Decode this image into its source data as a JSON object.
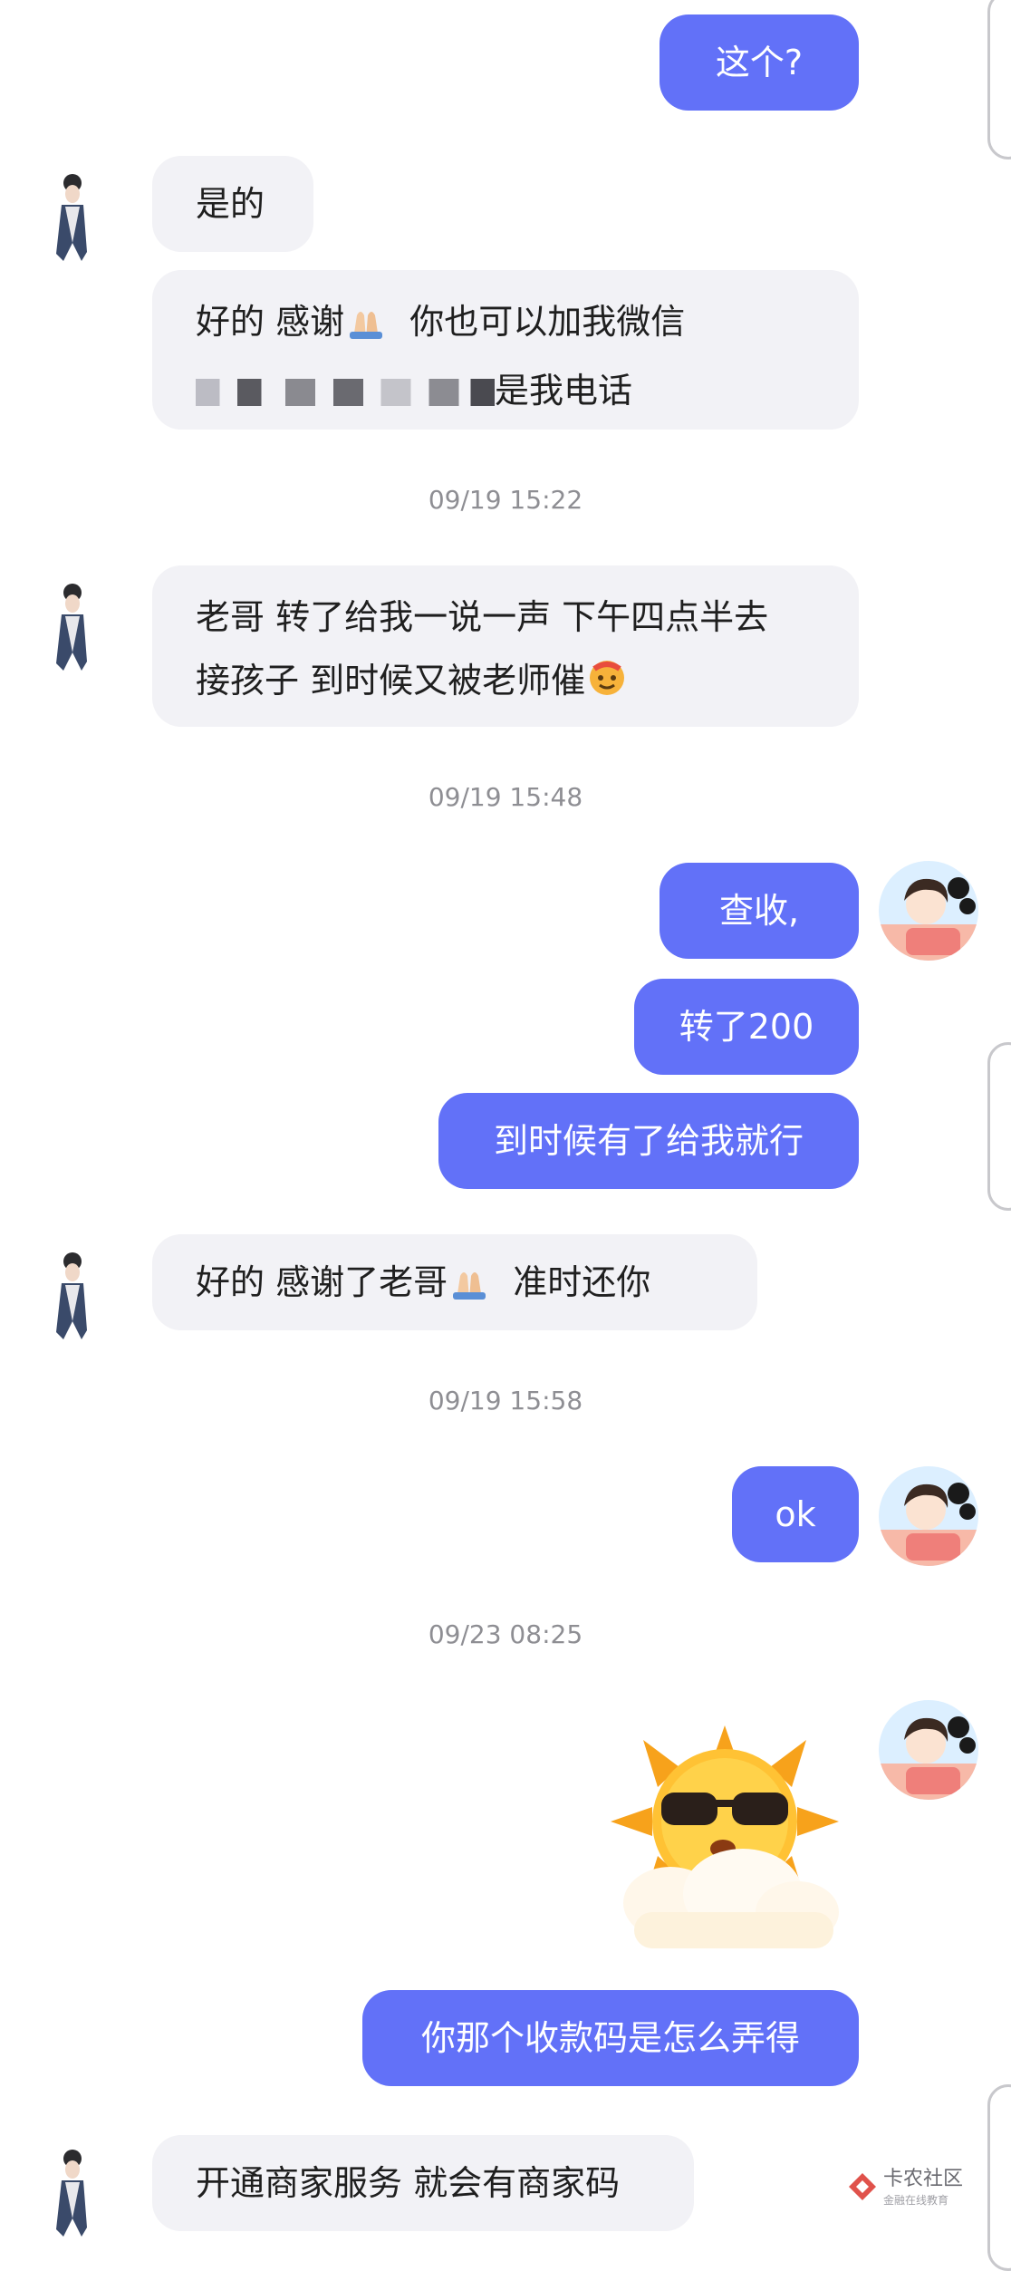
{
  "messages": {
    "m1": "这个?",
    "m2": "是的",
    "m3_line1_a": "好的 感谢",
    "m3_line1_b": "你也可以加我微信",
    "m3_line2": "是我电话",
    "ts1": "09/19 15:22",
    "m4_line1": "老哥 转了给我一说一声 下午四点半去",
    "m4_line2": "接孩子 到时候又被老师催",
    "ts2": "09/19 15:48",
    "m5": "查收,",
    "m6": "转了200",
    "m7": "到时候有了给我就行",
    "m8_a": "好的  感谢了老哥",
    "m8_b": "准时还你",
    "ts3": "09/19 15:58",
    "m9": "ok",
    "ts4": "09/23 08:25",
    "m10": "你那个收款码是怎么弄得",
    "m11": "开通商家服务 就会有商家码"
  },
  "sticker": "sun-with-sunglasses-sticker",
  "watermark": {
    "title": "卡农社区",
    "subtitle": "金融在线教育"
  },
  "colors": {
    "sent_bubble": "#6271f8",
    "received_bubble": "#f2f2f6",
    "timestamp": "#8e8e93"
  }
}
